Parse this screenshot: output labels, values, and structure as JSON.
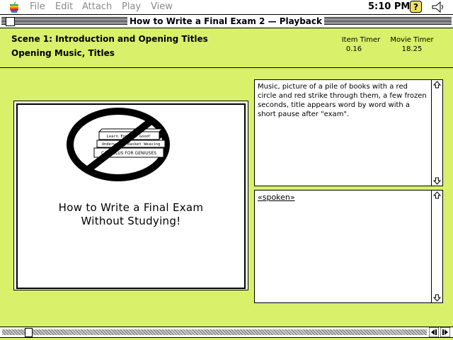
{
  "menubar": {
    "apple_icon": "apple-icon",
    "items": [
      "File",
      "Edit",
      "Attach",
      "Play",
      "View"
    ],
    "clock": "5:10 PM",
    "help_icon": "help-question-icon",
    "app_icon": "speaker-app-icon"
  },
  "window": {
    "title": "How to Write a Final Exam 2 — Playback"
  },
  "header": {
    "scene_line": "Scene 1:  Introduction and Opening Titles",
    "subtitle": "Opening Music, Titles",
    "item_timer_label": "Item Timer",
    "item_timer_value": "0.16",
    "movie_timer_label": "Movie Timer",
    "movie_timer_value": "18.25"
  },
  "preview": {
    "slide_title_line1": "How to Write a Final Exam",
    "slide_title_line2": "Without Studying!",
    "book_labels": [
      "Learn English Good!",
      "Underwater Basket Weaving",
      "CALCULUS FOR GENIUSES"
    ]
  },
  "notes": {
    "description": "Music, picture of a pile of books with a red circle and red strike through them, a few frozen seconds, title appears word by word with a short pause after \"exam\".",
    "spoken": "«spoken»"
  },
  "colors": {
    "background": "#d8f06a"
  }
}
